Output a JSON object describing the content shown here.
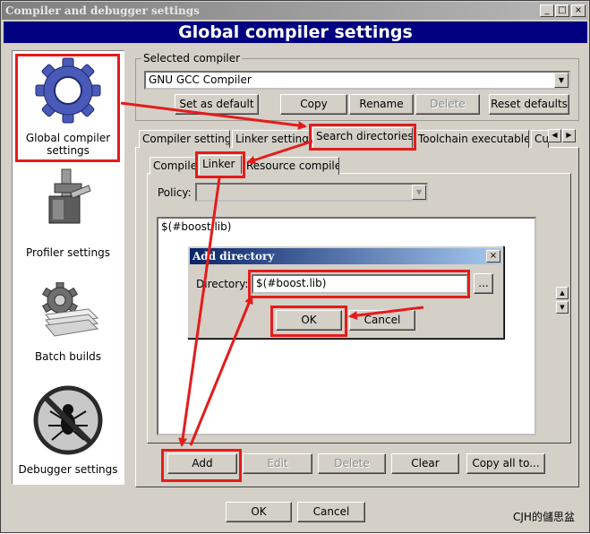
{
  "window": {
    "title": "Compiler and debugger settings",
    "controls": {
      "minimize": "_",
      "maximize": "□",
      "close": "×"
    }
  },
  "header": {
    "title": "Global compiler settings"
  },
  "sidebar": {
    "items": [
      {
        "label": "Global compiler settings",
        "icon": "gear-icon"
      },
      {
        "label": "Profiler settings",
        "icon": "caliper-icon"
      },
      {
        "label": "Batch builds",
        "icon": "stack-gear-icon"
      },
      {
        "label": "Debugger settings",
        "icon": "no-bug-icon"
      }
    ]
  },
  "selected_compiler": {
    "legend": "Selected compiler",
    "value": "GNU GCC Compiler",
    "buttons": {
      "set_default": "Set as default",
      "copy": "Copy",
      "rename": "Rename",
      "delete": "Delete",
      "reset": "Reset defaults"
    }
  },
  "main_tabs": [
    "Compiler settings",
    "Linker settings",
    "Search directories",
    "Toolchain executables",
    "Cu"
  ],
  "sub_tabs": [
    "Compiler",
    "Linker",
    "Resource compiler"
  ],
  "policy": {
    "label": "Policy:",
    "value": ""
  },
  "directories": [
    "$(#boost.lib)"
  ],
  "list_buttons": {
    "add": "Add",
    "edit": "Edit",
    "delete": "Delete",
    "clear": "Clear",
    "copy_all": "Copy all to..."
  },
  "dialog": {
    "title": "Add directory",
    "label": "Directory:",
    "value": "$(#boost.lib)",
    "browse": "...",
    "ok": "OK",
    "cancel": "Cancel",
    "close": "×"
  },
  "footer": {
    "ok": "OK",
    "cancel": "Cancel",
    "watermark": "CJH的儲思盆"
  },
  "colors": {
    "header": "#000080",
    "annotation": "#e51b1b",
    "face": "#d4d0c8"
  }
}
